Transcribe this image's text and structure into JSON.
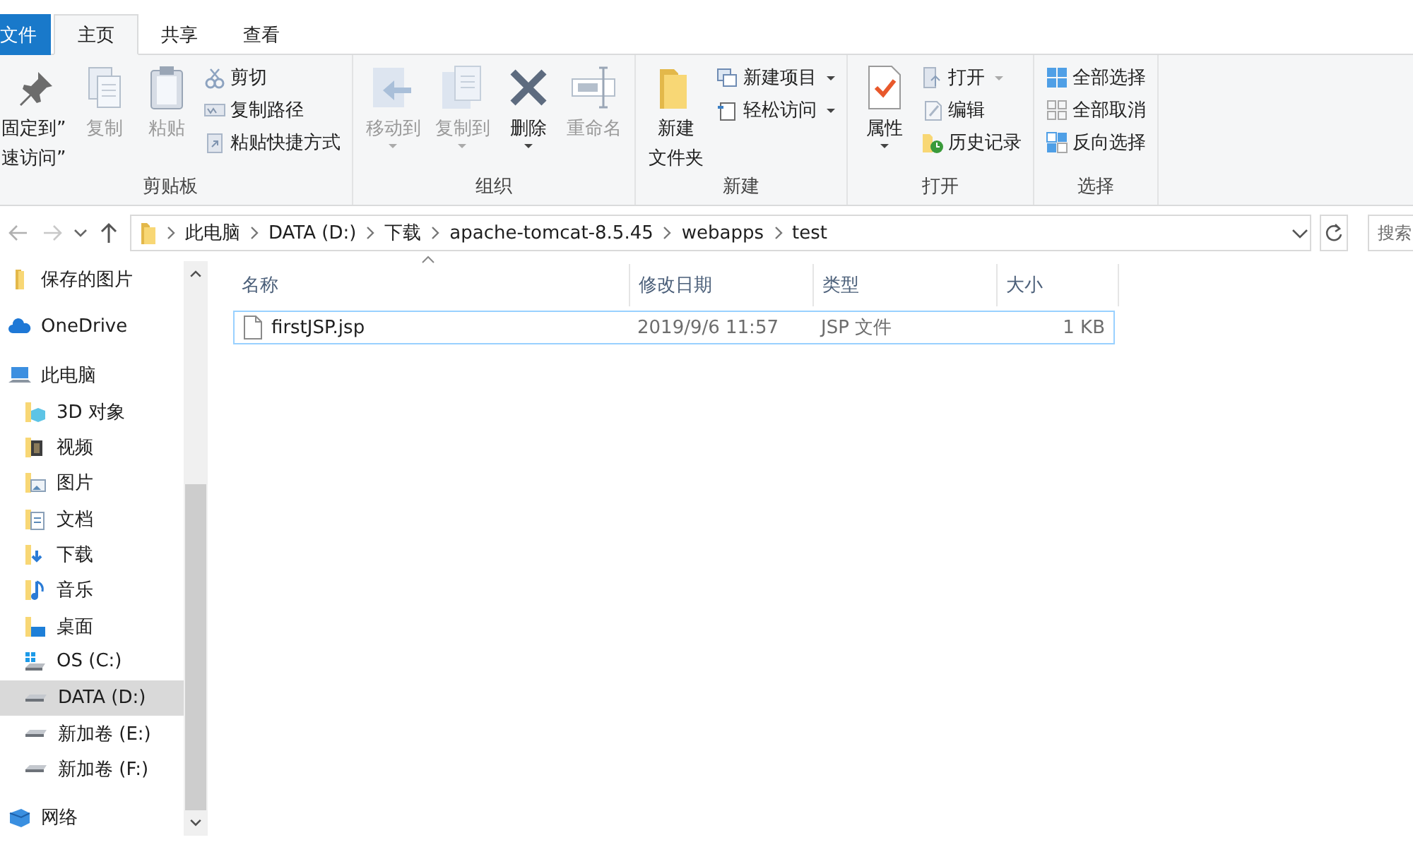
{
  "tabs": [
    {
      "label": "文件",
      "kind": "file",
      "selected": false
    },
    {
      "label": "主页",
      "kind": "tab",
      "selected": true
    },
    {
      "label": "共享",
      "kind": "tab",
      "selected": false
    },
    {
      "label": "查看",
      "kind": "tab",
      "selected": false
    }
  ],
  "ribbon": {
    "groups": [
      {
        "label": "剪贴板",
        "items": [
          {
            "kind": "large",
            "lines": [
              "固定到”",
              "速访问”"
            ],
            "disabled": false,
            "dropdown": false
          },
          {
            "kind": "large",
            "lines": [
              "复制"
            ],
            "disabled": true,
            "dropdown": false
          },
          {
            "kind": "large",
            "lines": [
              "粘贴"
            ],
            "disabled": true,
            "dropdown": false
          },
          {
            "kind": "stack",
            "buttons": [
              {
                "label": "剪切",
                "disabled": true,
                "dropdown": false
              },
              {
                "label": "复制路径",
                "disabled": true,
                "dropdown": false
              },
              {
                "label": "粘贴快捷方式",
                "disabled": true,
                "dropdown": false
              }
            ]
          }
        ]
      },
      {
        "label": "组织",
        "items": [
          {
            "kind": "large",
            "lines": [
              "移动到"
            ],
            "disabled": true,
            "dropdown": true
          },
          {
            "kind": "large",
            "lines": [
              "复制到"
            ],
            "disabled": true,
            "dropdown": true
          },
          {
            "kind": "large",
            "lines": [
              "删除"
            ],
            "disabled": false,
            "dropdown": true
          },
          {
            "kind": "large",
            "lines": [
              "重命名"
            ],
            "disabled": true,
            "dropdown": false
          }
        ]
      },
      {
        "label": "新建",
        "items": [
          {
            "kind": "large",
            "lines": [
              "新建",
              "文件夹"
            ],
            "disabled": false,
            "dropdown": false
          },
          {
            "kind": "stack",
            "buttons": [
              {
                "label": "新建项目",
                "disabled": false,
                "dropdown": true
              },
              {
                "label": "轻松访问",
                "disabled": false,
                "dropdown": true
              }
            ]
          }
        ]
      },
      {
        "label": "打开",
        "items": [
          {
            "kind": "large",
            "lines": [
              "属性"
            ],
            "disabled": false,
            "dropdown": true
          },
          {
            "kind": "stack",
            "buttons": [
              {
                "label": "打开",
                "disabled": true,
                "dropdown": true
              },
              {
                "label": "编辑",
                "disabled": true,
                "dropdown": false
              },
              {
                "label": "历史记录",
                "disabled": false,
                "dropdown": false
              }
            ]
          }
        ]
      },
      {
        "label": "选择",
        "items": [
          {
            "kind": "stack",
            "buttons": [
              {
                "label": "全部选择",
                "disabled": false,
                "dropdown": false
              },
              {
                "label": "全部取消",
                "disabled": false,
                "dropdown": false
              },
              {
                "label": "反向选择",
                "disabled": false,
                "dropdown": false
              }
            ]
          }
        ]
      }
    ]
  },
  "address": {
    "path": [
      "此电脑",
      "DATA (D:)",
      "下载",
      "apache-tomcat-8.5.45",
      "webapps",
      "test"
    ],
    "search_placeholder": "搜索"
  },
  "sidebar": {
    "items": [
      {
        "label": "保存的图片",
        "kind": "folder",
        "selected": false
      },
      {
        "label": "OneDrive",
        "kind": "cloud",
        "selected": false
      },
      {
        "label": "此电脑",
        "kind": "pc",
        "selected": false,
        "children": [
          {
            "label": "3D 对象",
            "kind": "obj3d",
            "selected": false
          },
          {
            "label": "视频",
            "kind": "video",
            "selected": false
          },
          {
            "label": "图片",
            "kind": "pictures",
            "selected": false
          },
          {
            "label": "文档",
            "kind": "docs",
            "selected": false
          },
          {
            "label": "下载",
            "kind": "download",
            "selected": false
          },
          {
            "label": "音乐",
            "kind": "music",
            "selected": false
          },
          {
            "label": "桌面",
            "kind": "desktop",
            "selected": false
          },
          {
            "label": "OS (C:)",
            "kind": "osdrive",
            "selected": false
          },
          {
            "label": "DATA (D:)",
            "kind": "drive",
            "selected": true
          },
          {
            "label": "新加卷 (E:)",
            "kind": "drive",
            "selected": false
          },
          {
            "label": "新加卷 (F:)",
            "kind": "drive",
            "selected": false
          }
        ]
      },
      {
        "label": "网络",
        "kind": "network",
        "selected": false
      }
    ]
  },
  "files": {
    "columns": [
      "名称",
      "修改日期",
      "类型",
      "大小"
    ],
    "rows": [
      {
        "name": "firstJSP.jsp",
        "modified": "2019/9/6 11:57",
        "type": "JSP 文件",
        "size": "1 KB",
        "hovered": true
      }
    ]
  }
}
